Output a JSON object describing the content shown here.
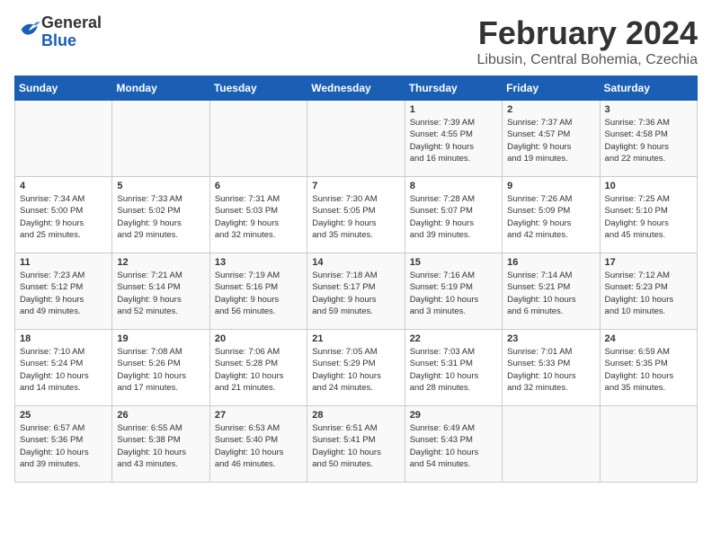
{
  "header": {
    "logo_general": "General",
    "logo_blue": "Blue",
    "month_year": "February 2024",
    "location": "Libusin, Central Bohemia, Czechia"
  },
  "days_of_week": [
    "Sunday",
    "Monday",
    "Tuesday",
    "Wednesday",
    "Thursday",
    "Friday",
    "Saturday"
  ],
  "weeks": [
    [
      {
        "day": "",
        "info": ""
      },
      {
        "day": "",
        "info": ""
      },
      {
        "day": "",
        "info": ""
      },
      {
        "day": "",
        "info": ""
      },
      {
        "day": "1",
        "info": "Sunrise: 7:39 AM\nSunset: 4:55 PM\nDaylight: 9 hours\nand 16 minutes."
      },
      {
        "day": "2",
        "info": "Sunrise: 7:37 AM\nSunset: 4:57 PM\nDaylight: 9 hours\nand 19 minutes."
      },
      {
        "day": "3",
        "info": "Sunrise: 7:36 AM\nSunset: 4:58 PM\nDaylight: 9 hours\nand 22 minutes."
      }
    ],
    [
      {
        "day": "4",
        "info": "Sunrise: 7:34 AM\nSunset: 5:00 PM\nDaylight: 9 hours\nand 25 minutes."
      },
      {
        "day": "5",
        "info": "Sunrise: 7:33 AM\nSunset: 5:02 PM\nDaylight: 9 hours\nand 29 minutes."
      },
      {
        "day": "6",
        "info": "Sunrise: 7:31 AM\nSunset: 5:03 PM\nDaylight: 9 hours\nand 32 minutes."
      },
      {
        "day": "7",
        "info": "Sunrise: 7:30 AM\nSunset: 5:05 PM\nDaylight: 9 hours\nand 35 minutes."
      },
      {
        "day": "8",
        "info": "Sunrise: 7:28 AM\nSunset: 5:07 PM\nDaylight: 9 hours\nand 39 minutes."
      },
      {
        "day": "9",
        "info": "Sunrise: 7:26 AM\nSunset: 5:09 PM\nDaylight: 9 hours\nand 42 minutes."
      },
      {
        "day": "10",
        "info": "Sunrise: 7:25 AM\nSunset: 5:10 PM\nDaylight: 9 hours\nand 45 minutes."
      }
    ],
    [
      {
        "day": "11",
        "info": "Sunrise: 7:23 AM\nSunset: 5:12 PM\nDaylight: 9 hours\nand 49 minutes."
      },
      {
        "day": "12",
        "info": "Sunrise: 7:21 AM\nSunset: 5:14 PM\nDaylight: 9 hours\nand 52 minutes."
      },
      {
        "day": "13",
        "info": "Sunrise: 7:19 AM\nSunset: 5:16 PM\nDaylight: 9 hours\nand 56 minutes."
      },
      {
        "day": "14",
        "info": "Sunrise: 7:18 AM\nSunset: 5:17 PM\nDaylight: 9 hours\nand 59 minutes."
      },
      {
        "day": "15",
        "info": "Sunrise: 7:16 AM\nSunset: 5:19 PM\nDaylight: 10 hours\nand 3 minutes."
      },
      {
        "day": "16",
        "info": "Sunrise: 7:14 AM\nSunset: 5:21 PM\nDaylight: 10 hours\nand 6 minutes."
      },
      {
        "day": "17",
        "info": "Sunrise: 7:12 AM\nSunset: 5:23 PM\nDaylight: 10 hours\nand 10 minutes."
      }
    ],
    [
      {
        "day": "18",
        "info": "Sunrise: 7:10 AM\nSunset: 5:24 PM\nDaylight: 10 hours\nand 14 minutes."
      },
      {
        "day": "19",
        "info": "Sunrise: 7:08 AM\nSunset: 5:26 PM\nDaylight: 10 hours\nand 17 minutes."
      },
      {
        "day": "20",
        "info": "Sunrise: 7:06 AM\nSunset: 5:28 PM\nDaylight: 10 hours\nand 21 minutes."
      },
      {
        "day": "21",
        "info": "Sunrise: 7:05 AM\nSunset: 5:29 PM\nDaylight: 10 hours\nand 24 minutes."
      },
      {
        "day": "22",
        "info": "Sunrise: 7:03 AM\nSunset: 5:31 PM\nDaylight: 10 hours\nand 28 minutes."
      },
      {
        "day": "23",
        "info": "Sunrise: 7:01 AM\nSunset: 5:33 PM\nDaylight: 10 hours\nand 32 minutes."
      },
      {
        "day": "24",
        "info": "Sunrise: 6:59 AM\nSunset: 5:35 PM\nDaylight: 10 hours\nand 35 minutes."
      }
    ],
    [
      {
        "day": "25",
        "info": "Sunrise: 6:57 AM\nSunset: 5:36 PM\nDaylight: 10 hours\nand 39 minutes."
      },
      {
        "day": "26",
        "info": "Sunrise: 6:55 AM\nSunset: 5:38 PM\nDaylight: 10 hours\nand 43 minutes."
      },
      {
        "day": "27",
        "info": "Sunrise: 6:53 AM\nSunset: 5:40 PM\nDaylight: 10 hours\nand 46 minutes."
      },
      {
        "day": "28",
        "info": "Sunrise: 6:51 AM\nSunset: 5:41 PM\nDaylight: 10 hours\nand 50 minutes."
      },
      {
        "day": "29",
        "info": "Sunrise: 6:49 AM\nSunset: 5:43 PM\nDaylight: 10 hours\nand 54 minutes."
      },
      {
        "day": "",
        "info": ""
      },
      {
        "day": "",
        "info": ""
      }
    ]
  ]
}
